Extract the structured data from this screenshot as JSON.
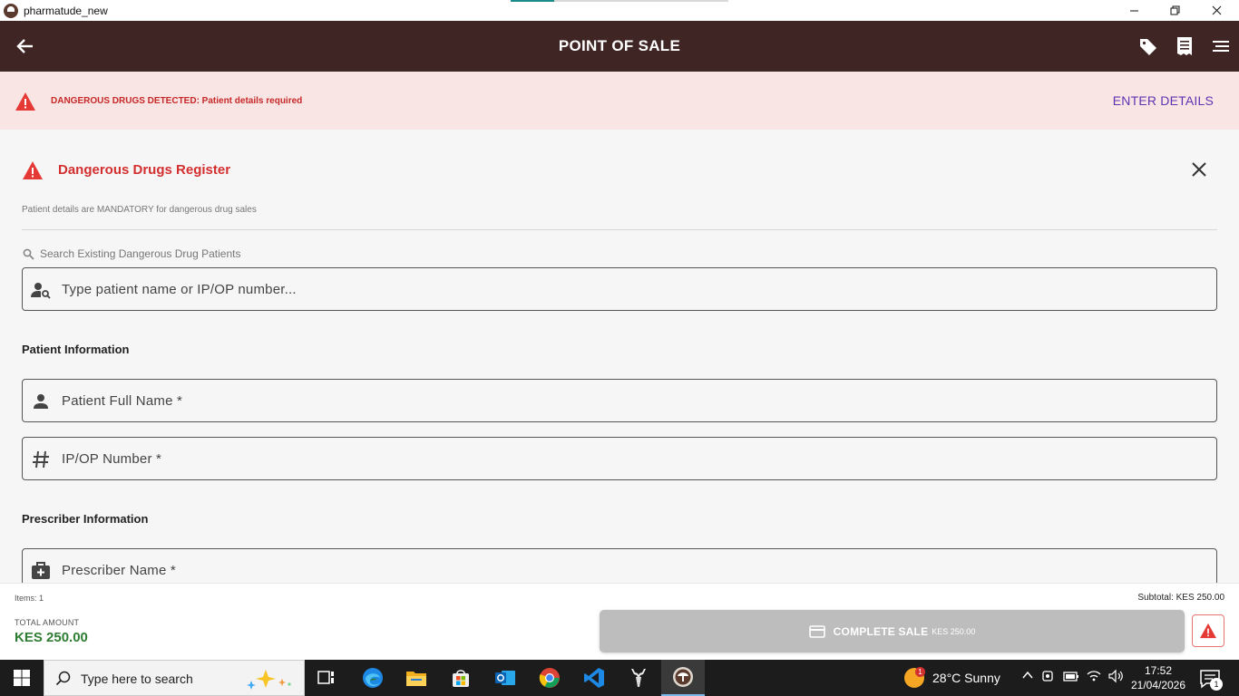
{
  "window": {
    "title": "pharmatude_new",
    "controls": {
      "minimize": "—",
      "maximize": "❐",
      "close": "✕"
    }
  },
  "header": {
    "title": "POINT OF SALE",
    "icons": [
      "arrow-back-icon",
      "tag-icon",
      "receipt-icon",
      "menu-icon"
    ]
  },
  "alert_banner": {
    "message": "DANGEROUS DRUGS DETECTED: Patient details required",
    "action": "ENTER DETAILS",
    "color": "#c62828",
    "background": "#f9e5e4"
  },
  "register": {
    "title": "Dangerous Drugs Register",
    "subtitle": "Patient details are MANDATORY for dangerous drug sales",
    "search_label": "Search Existing Dangerous Drug Patients",
    "search_placeholder": "Type patient name or IP/OP number...",
    "patient_section": "Patient Information",
    "patient_name_label": "Patient Full Name *",
    "ipop_label": "IP/OP Number *",
    "prescriber_section": "Prescriber Information",
    "prescriber_name_label": "Prescriber Name *"
  },
  "footer": {
    "items": "Items: 1",
    "subtotal": "Subtotal: KES 250.00",
    "total_label": "TOTAL AMOUNT",
    "total_value": "KES 250.00",
    "complete_label": "COMPLETE SALE",
    "complete_amount": "KES 250.00",
    "total_color": "#2e7d32"
  },
  "taskbar": {
    "search_text": "Type here to search",
    "weather": "28°C  Sunny",
    "weather_badge": "1",
    "time": "17:52",
    "date": "21/04/2026",
    "notification_count": "1",
    "apps": [
      "task-view-icon",
      "edge-icon",
      "file-explorer-icon",
      "store-icon",
      "outlook-icon",
      "chrome-icon",
      "vscode-icon",
      "app-deer-icon",
      "pharmatude-icon"
    ]
  }
}
